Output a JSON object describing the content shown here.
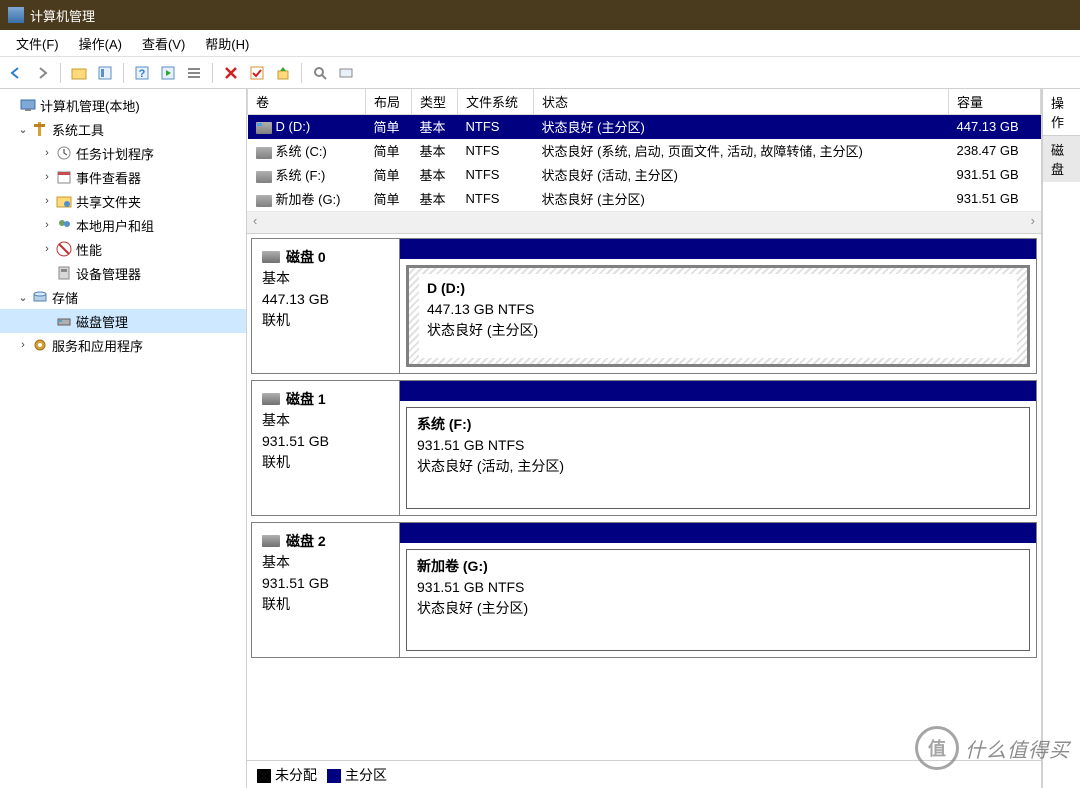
{
  "window": {
    "title": "计算机管理"
  },
  "menu": {
    "file": "文件(F)",
    "action": "操作(A)",
    "view": "查看(V)",
    "help": "帮助(H)"
  },
  "tree": {
    "root": "计算机管理(本地)",
    "systools": "系统工具",
    "tasksched": "任务计划程序",
    "eventvwr": "事件查看器",
    "shared": "共享文件夹",
    "localusers": "本地用户和组",
    "perf": "性能",
    "devmgr": "设备管理器",
    "storage": "存储",
    "diskmgmt": "磁盘管理",
    "services": "服务和应用程序"
  },
  "vol_headers": {
    "volume": "卷",
    "layout": "布局",
    "type": "类型",
    "fs": "文件系统",
    "status": "状态",
    "capacity": "容量"
  },
  "volumes": [
    {
      "name": "D (D:)",
      "layout": "简单",
      "type": "基本",
      "fs": "NTFS",
      "status": "状态良好 (主分区)",
      "capacity": "447.13 GB",
      "selected": true,
      "blue": true
    },
    {
      "name": "系统 (C:)",
      "layout": "简单",
      "type": "基本",
      "fs": "NTFS",
      "status": "状态良好 (系统, 启动, 页面文件, 活动, 故障转储, 主分区)",
      "capacity": "238.47 GB"
    },
    {
      "name": "系统 (F:)",
      "layout": "简单",
      "type": "基本",
      "fs": "NTFS",
      "status": "状态良好 (活动, 主分区)",
      "capacity": "931.51 GB"
    },
    {
      "name": "新加卷 (G:)",
      "layout": "简单",
      "type": "基本",
      "fs": "NTFS",
      "status": "状态良好 (主分区)",
      "capacity": "931.51 GB"
    }
  ],
  "disks": [
    {
      "title": "磁盘 0",
      "kind": "基本",
      "size": "447.13 GB",
      "state": "联机",
      "part": {
        "name": "D  (D:)",
        "detail": "447.13 GB NTFS",
        "status": "状态良好 (主分区)",
        "hatched": true
      }
    },
    {
      "title": "磁盘 1",
      "kind": "基本",
      "size": "931.51 GB",
      "state": "联机",
      "part": {
        "name": "系统  (F:)",
        "detail": "931.51 GB NTFS",
        "status": "状态良好 (活动, 主分区)",
        "hatched": false
      }
    },
    {
      "title": "磁盘 2",
      "kind": "基本",
      "size": "931.51 GB",
      "state": "联机",
      "part": {
        "name": "新加卷  (G:)",
        "detail": "931.51 GB NTFS",
        "status": "状态良好 (主分区)",
        "hatched": false
      }
    }
  ],
  "legend": {
    "unallocated": "未分配",
    "primary": "主分区"
  },
  "actions": {
    "header": "操作",
    "item1": "磁盘"
  },
  "watermark": {
    "badge": "值",
    "text": "什么值得买"
  }
}
